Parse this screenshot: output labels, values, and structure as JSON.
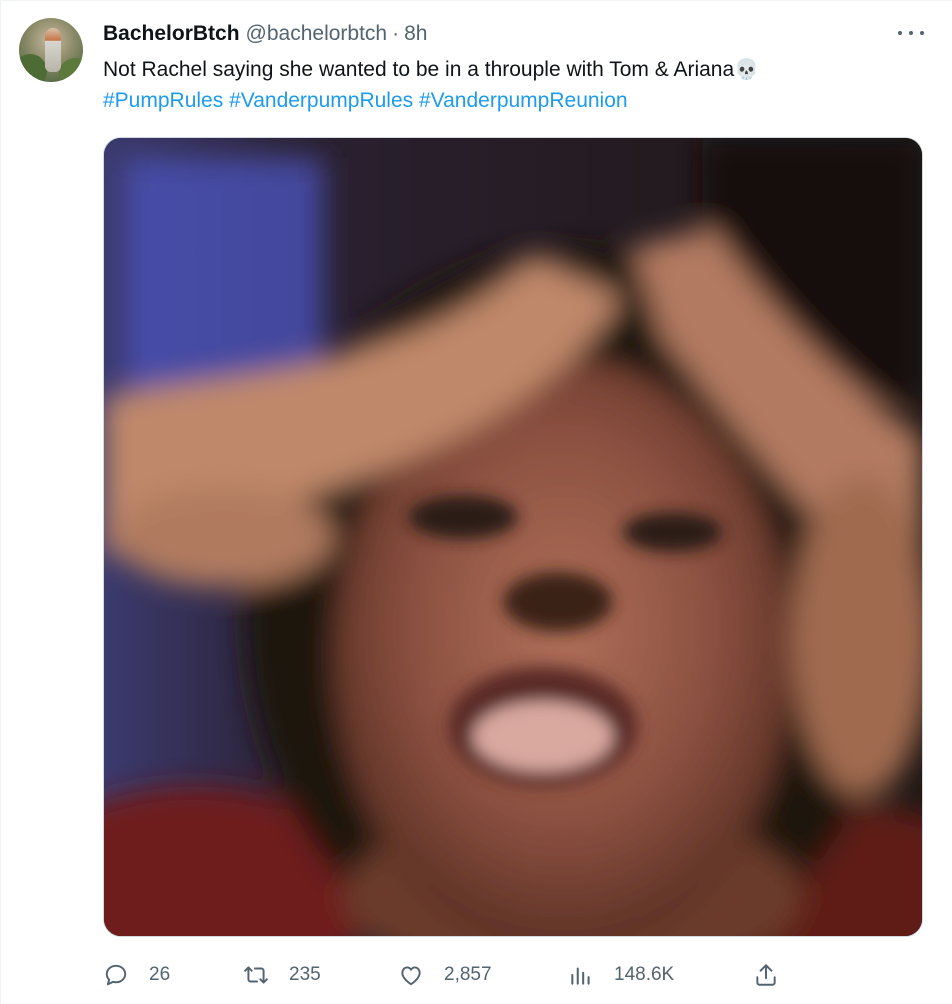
{
  "author": {
    "display_name": "BachelorBtch",
    "handle": "@bachelorbtch",
    "separator": "·",
    "time": "8h"
  },
  "tweet": {
    "text": "Not Rachel saying she wanted to be in a throuple with Tom & Ariana",
    "emoji": "💀",
    "hashtags": [
      "#PumpRules",
      "#VanderpumpRules",
      "#VanderpumpReunion"
    ]
  },
  "media": {
    "icon": "image-photo"
  },
  "actions": {
    "replies": "26",
    "retweets": "235",
    "likes": "2,857",
    "views": "148.6K"
  },
  "icons": {
    "reply": "reply-icon",
    "retweet": "retweet-icon",
    "like": "heart-icon",
    "views": "views-icon",
    "share": "share-icon",
    "more": "more-icon"
  },
  "colors": {
    "link": "#1d9bf0",
    "secondary_text": "#536471",
    "primary_text": "#0f1419"
  }
}
